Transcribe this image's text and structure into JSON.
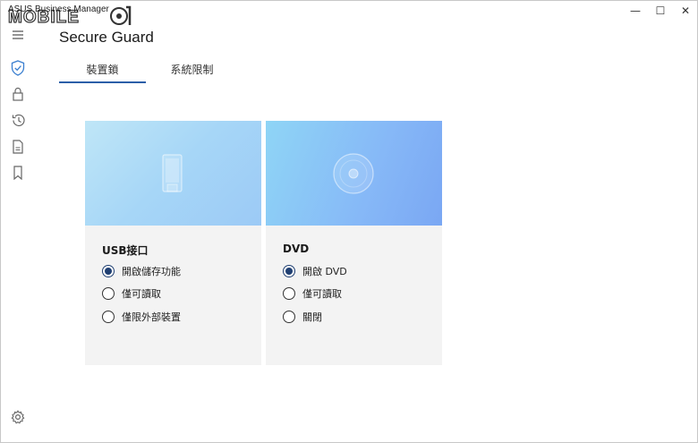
{
  "window": {
    "app_title": "ASUS Business Manager",
    "controls": {
      "minimize": "—",
      "maximize": "☐",
      "close": "✕"
    }
  },
  "sidebar": {
    "items": [
      {
        "icon": "menu-icon"
      },
      {
        "icon": "shield-check-icon",
        "active": true
      },
      {
        "icon": "lock-icon"
      },
      {
        "icon": "history-icon"
      },
      {
        "icon": "document-icon"
      },
      {
        "icon": "bookmark-icon"
      }
    ],
    "bottom": {
      "icon": "gear-icon"
    }
  },
  "header": {
    "title": "Secure Guard",
    "tabs": [
      {
        "label": "裝置鎖",
        "selected": true
      },
      {
        "label": "系統限制",
        "selected": false
      }
    ]
  },
  "cards": [
    {
      "title": "USB接口",
      "illustration": "usb-drive-icon",
      "options": [
        {
          "label": "開啟儲存功能",
          "checked": true
        },
        {
          "label": "僅可讀取",
          "checked": false
        },
        {
          "label": "僅限外部裝置",
          "checked": false
        }
      ]
    },
    {
      "title": "DVD",
      "illustration": "disc-icon",
      "options": [
        {
          "label": "開啟 DVD",
          "checked": true
        },
        {
          "label": "僅可讀取",
          "checked": false
        },
        {
          "label": "關閉",
          "checked": false
        }
      ]
    }
  ],
  "colors": {
    "accent": "#2c5fa8",
    "radio_selected": "#1f3f72",
    "card_bg": "#f3f3f3"
  }
}
